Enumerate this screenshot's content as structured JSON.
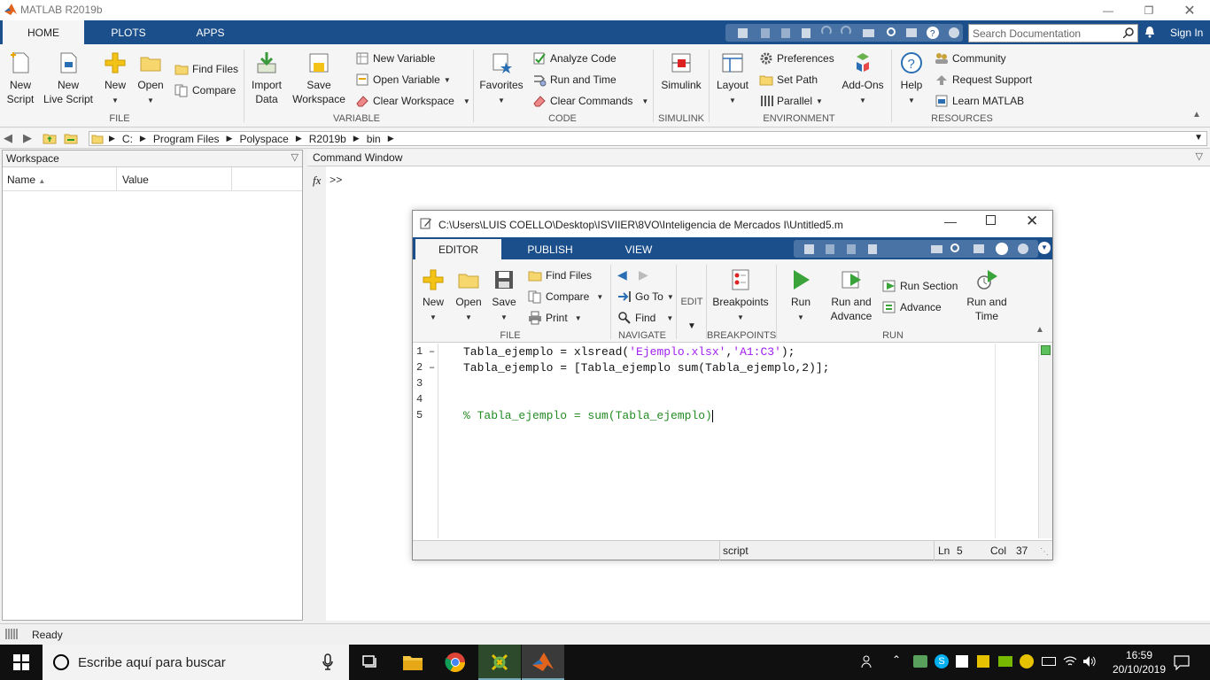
{
  "window": {
    "title": "MATLAB R2019b"
  },
  "tabs": [
    {
      "label": "HOME"
    },
    {
      "label": "PLOTS"
    },
    {
      "label": "APPS"
    }
  ],
  "search": {
    "placeholder": "Search Documentation"
  },
  "signin_label": "Sign In",
  "ribbon": {
    "file": {
      "new_script": "New\nScript",
      "new_live_script": "New\nLive Script",
      "new": "New",
      "open": "Open",
      "find_files": "Find Files",
      "compare": "Compare",
      "group": "FILE"
    },
    "variable": {
      "import_data": "Import\nData",
      "save_workspace": "Save\nWorkspace",
      "new_variable": "New Variable",
      "open_variable": "Open Variable",
      "clear_workspace": "Clear Workspace",
      "group": "VARIABLE"
    },
    "code": {
      "favorites": "Favorites",
      "analyze_code": "Analyze Code",
      "run_and_time": "Run and Time",
      "clear_commands": "Clear Commands",
      "group": "CODE"
    },
    "simulink": {
      "simulink": "Simulink",
      "group": "SIMULINK"
    },
    "environment": {
      "layout": "Layout",
      "preferences": "Preferences",
      "set_path": "Set Path",
      "parallel": "Parallel",
      "add_ons": "Add-Ons",
      "group": "ENVIRONMENT"
    },
    "resources": {
      "help": "Help",
      "community": "Community",
      "request_support": "Request Support",
      "learn_matlab": "Learn MATLAB",
      "group": "RESOURCES"
    }
  },
  "address": {
    "segments": [
      "C:",
      "Program Files",
      "Polyspace",
      "R2019b",
      "bin"
    ]
  },
  "workspace": {
    "title": "Workspace",
    "col_name": "Name",
    "col_value": "Value"
  },
  "command_window": {
    "title": "Command Window",
    "fx": "fx",
    "prompt": ">>"
  },
  "editor": {
    "title": "C:\\Users\\LUIS COELLO\\Desktop\\ISVIIER\\8VO\\Inteligencia de Mercados I\\Untitled5.m",
    "tabs": [
      {
        "label": "EDITOR"
      },
      {
        "label": "PUBLISH"
      },
      {
        "label": "VIEW"
      }
    ],
    "ribbon": {
      "new": "New",
      "open": "Open",
      "save": "Save",
      "find_files": "Find Files",
      "compare": "Compare",
      "print": "Print",
      "file_group": "FILE",
      "go_to": "Go To",
      "find": "Find",
      "navigate_group": "NAVIGATE",
      "edit": "EDIT",
      "breakpoints": "Breakpoints",
      "breakpoints_group": "BREAKPOINTS",
      "run": "Run",
      "run_and_advance": "Run and\nAdvance",
      "run_section": "Run Section",
      "advance": "Advance",
      "run_and_time": "Run and\nTime",
      "run_group": "RUN"
    },
    "lines": [
      {
        "num": "1",
        "marker": "–"
      },
      {
        "num": "2",
        "marker": "–"
      },
      {
        "num": "3",
        "marker": ""
      },
      {
        "num": "4",
        "marker": ""
      },
      {
        "num": "5",
        "marker": ""
      }
    ],
    "code": {
      "l1a": "Tabla_ejemplo = xlsread(",
      "l1s1": "'Ejemplo.xlsx'",
      "l1c": ",",
      "l1s2": "'A1:C3'",
      "l1e": ");",
      "l2": "Tabla_ejemplo = [Tabla_ejemplo sum(Tabla_ejemplo,2)];",
      "l5": "% Tabla_ejemplo = sum(Tabla_ejemplo)"
    },
    "status": {
      "type": "script",
      "ln_label": "Ln",
      "ln": "5",
      "col_label": "Col",
      "col": "37"
    }
  },
  "statusbar": {
    "text": "Ready"
  },
  "taskbar": {
    "search_placeholder": "Escribe aquí para buscar",
    "time": "16:59",
    "date": "20/10/2019"
  },
  "colors": {
    "matlab_blue": "#1b4f8b",
    "string": "#a020f0",
    "comment": "#228b22"
  }
}
